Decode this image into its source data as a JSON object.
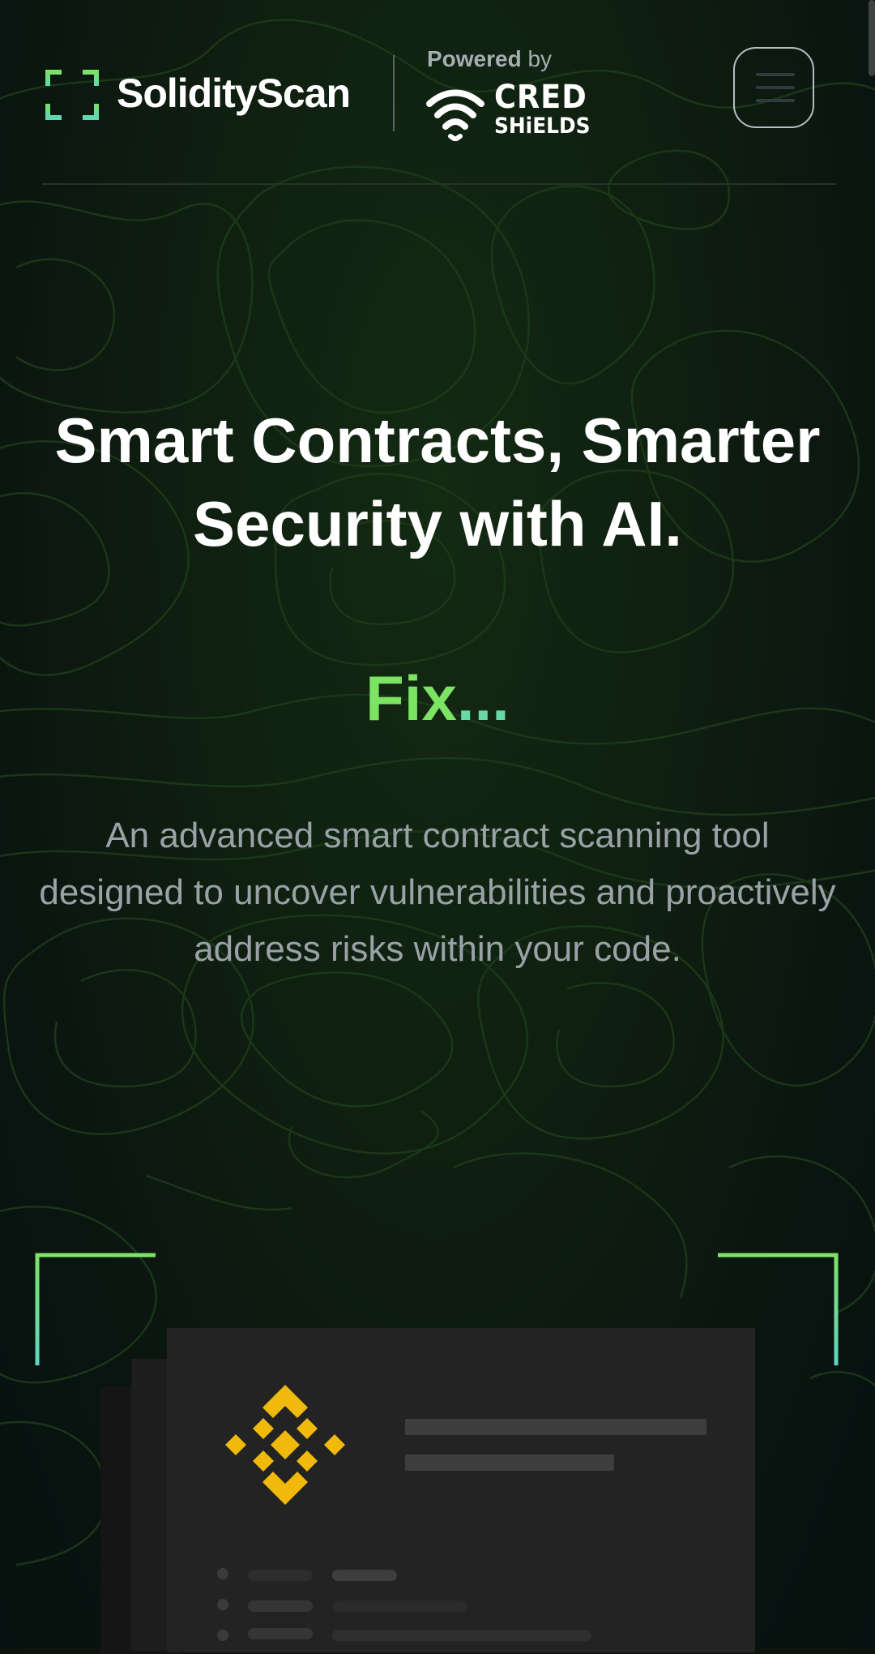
{
  "header": {
    "brand_name": "SolidityScan",
    "powered_label": "Powered",
    "powered_by": "by",
    "partner_line1": "CRED",
    "partner_line2": "SHiELDS",
    "logo_icon": "scan-frame-icon",
    "partner_icon": "wifi-shield-icon",
    "menu_icon": "hamburger-menu-icon"
  },
  "hero": {
    "title": "Smart Contracts, Smarter Security with AI.",
    "rotating_word": "Fix",
    "rotating_dots": "...",
    "subtitle": "An advanced smart contract scanning tool designed to uncover vulnerabilities and proactively address risks within your code."
  },
  "preview_card": {
    "icon": "binance-icon"
  },
  "colors": {
    "background": "#0b140d",
    "accent_green": "#7ce363",
    "accent_teal": "#6ad8a6",
    "brand_yellow": "#f0b90b",
    "subtitle_gray": "#9aa2a8"
  }
}
